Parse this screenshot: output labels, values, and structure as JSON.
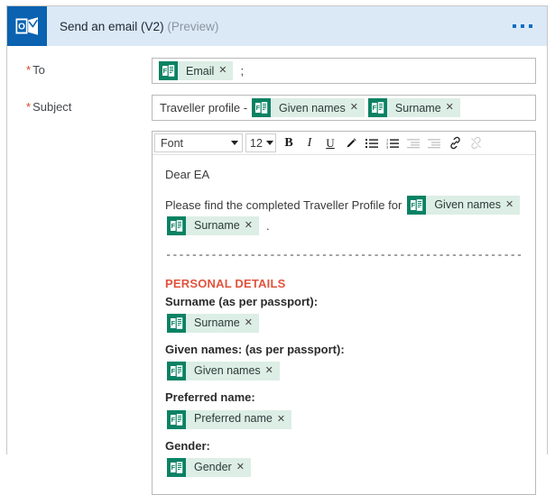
{
  "header": {
    "icon": "outlook-icon",
    "title": "Send an email (V2)",
    "preview_tag": "(Preview)",
    "more_menu": "…",
    "bg_color": "#dbe9f7",
    "icon_bg_color": "#0a62b0"
  },
  "fields": {
    "to": {
      "label": "To",
      "required_mark": "*",
      "tokens": [
        {
          "label": "Email",
          "close": "✕"
        }
      ],
      "trailing_text": ";"
    },
    "subject": {
      "label": "Subject",
      "required_mark": "*",
      "prefix_text": "Traveller profile -",
      "tokens": [
        {
          "label": "Given names",
          "close": "✕"
        },
        {
          "label": "Surname",
          "close": "✕"
        }
      ]
    },
    "body": {
      "label": "",
      "required_mark": ""
    }
  },
  "toolbar": {
    "font_name": "Font",
    "font_size": "12",
    "buttons": [
      {
        "name": "bold-icon",
        "glyph": "B",
        "enabled": true
      },
      {
        "name": "italic-icon",
        "glyph": "I",
        "enabled": true
      },
      {
        "name": "underline-icon",
        "glyph": "U",
        "enabled": true
      },
      {
        "name": "text-color-icon",
        "glyph": "✎",
        "enabled": true
      },
      {
        "name": "bulleted-list-icon",
        "glyph": "☰",
        "enabled": true
      },
      {
        "name": "numbered-list-icon",
        "glyph": "☰",
        "enabled": true
      },
      {
        "name": "decrease-indent-icon",
        "glyph": "☰",
        "enabled": false
      },
      {
        "name": "increase-indent-icon",
        "glyph": "☰",
        "enabled": false
      },
      {
        "name": "insert-link-icon",
        "glyph": "🔗",
        "enabled": true
      },
      {
        "name": "remove-link-icon",
        "glyph": "🔗",
        "enabled": false
      }
    ]
  },
  "email_body": {
    "greeting": "Dear EA",
    "intro_prefix": "Please find the completed Traveller Profile for",
    "intro_token_1": {
      "label": "Given names",
      "close": "✕"
    },
    "intro_token_2": {
      "label": "Surname",
      "close": "✕"
    },
    "intro_suffix": ".",
    "divider": "-------------------------------------------------------",
    "section_heading": "PERSONAL DETAILS",
    "section_heading_color": "#e2533d",
    "entries": [
      {
        "label": "Surname (as per passport):",
        "token": {
          "label": "Surname",
          "close": "✕"
        }
      },
      {
        "label": "Given names: (as per passport):",
        "token": {
          "label": "Given names",
          "close": "✕"
        }
      },
      {
        "label": "Preferred name:",
        "token": {
          "label": "Preferred name",
          "close": "✕"
        }
      },
      {
        "label": "Gender:",
        "token": {
          "label": "Gender",
          "close": "✕"
        }
      }
    ]
  },
  "theme": {
    "token_bg": "#dceee6",
    "token_icon_bg": "#0a8263",
    "required_color": "#d24726",
    "accent_blue": "#0c6ec4"
  }
}
